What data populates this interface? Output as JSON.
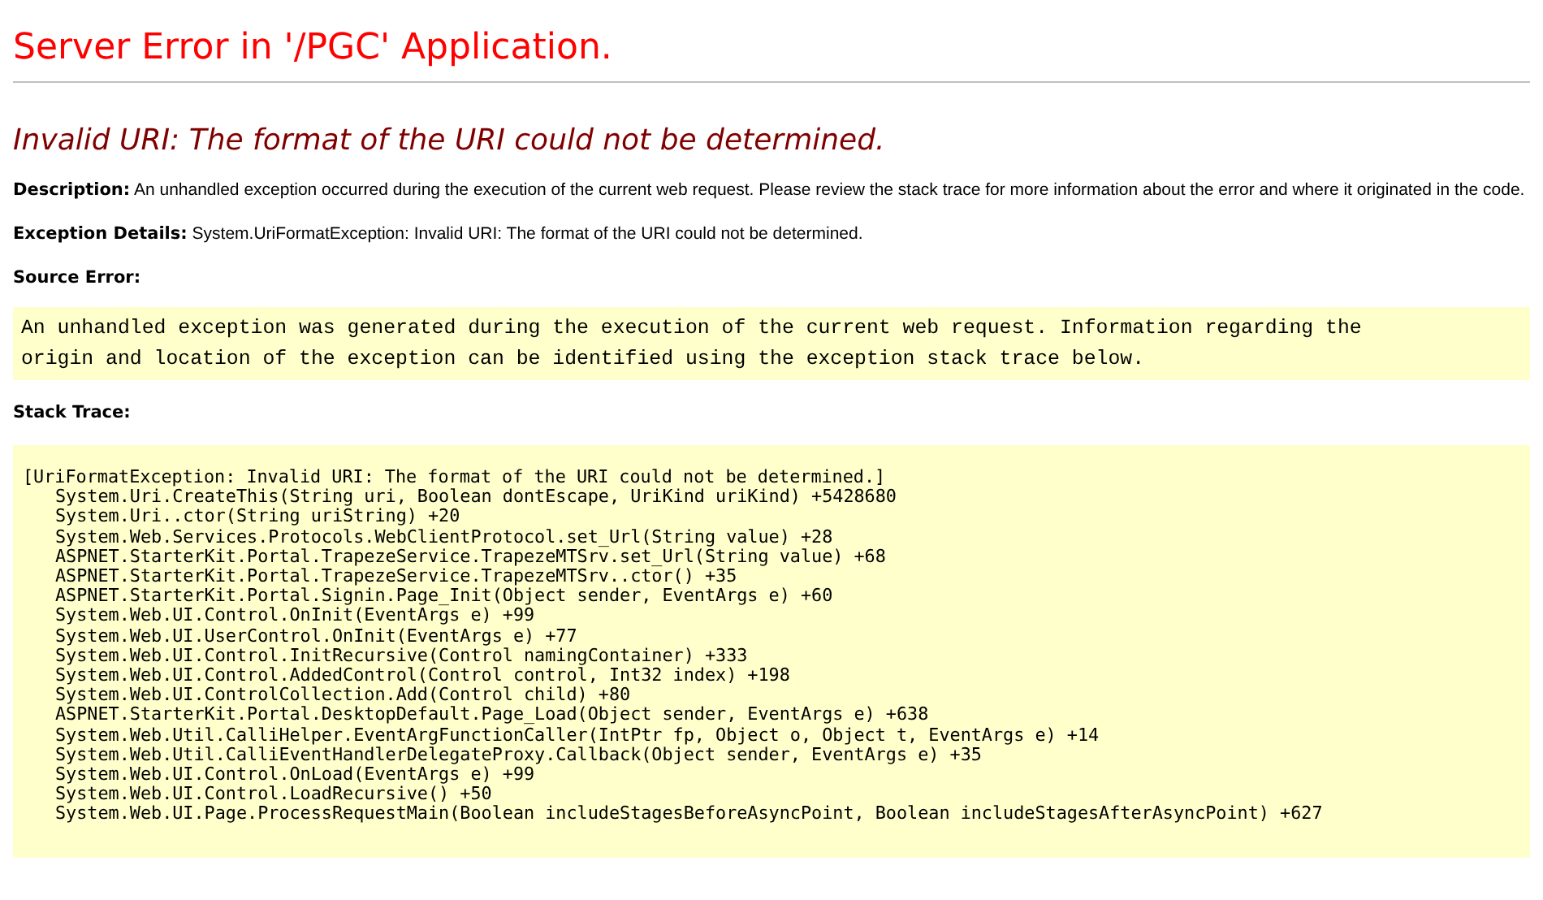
{
  "title": "Server Error in '/PGC' Application.",
  "error_heading": "Invalid URI: The format of the URI could not be determined.",
  "description": {
    "label": "Description:",
    "text": "An unhandled exception occurred during the execution of the current web request. Please review the stack trace for more information about the error and where it originated in the code."
  },
  "exception_details": {
    "label": "Exception Details:",
    "text": "System.UriFormatException: Invalid URI: The format of the URI could not be determined."
  },
  "source_error": {
    "label": "Source Error:",
    "lines": [
      "An unhandled exception was generated during the execution of the current web request. Information regarding the",
      "origin and location of the exception can be identified using the exception stack trace below."
    ]
  },
  "stack_trace": {
    "label": "Stack Trace:",
    "header": "[UriFormatException: Invalid URI: The format of the URI could not be determined.]",
    "frames": [
      "System.Uri.CreateThis(String uri, Boolean dontEscape, UriKind uriKind) +5428680",
      "System.Uri..ctor(String uriString) +20",
      "System.Web.Services.Protocols.WebClientProtocol.set_Url(String value) +28",
      "ASPNET.StarterKit.Portal.TrapezeService.TrapezeMTSrv.set_Url(String value) +68",
      "ASPNET.StarterKit.Portal.TrapezeService.TrapezeMTSrv..ctor() +35",
      "ASPNET.StarterKit.Portal.Signin.Page_Init(Object sender, EventArgs e) +60",
      "System.Web.UI.Control.OnInit(EventArgs e) +99",
      "System.Web.UI.UserControl.OnInit(EventArgs e) +77",
      "System.Web.UI.Control.InitRecursive(Control namingContainer) +333",
      "System.Web.UI.Control.AddedControl(Control control, Int32 index) +198",
      "System.Web.UI.ControlCollection.Add(Control child) +80",
      "ASPNET.StarterKit.Portal.DesktopDefault.Page_Load(Object sender, EventArgs e) +638",
      "System.Web.Util.CalliHelper.EventArgFunctionCaller(IntPtr fp, Object o, Object t, EventArgs e) +14",
      "System.Web.Util.CalliEventHandlerDelegateProxy.Callback(Object sender, EventArgs e) +35",
      "System.Web.UI.Control.OnLoad(EventArgs e) +99",
      "System.Web.UI.Control.LoadRecursive() +50",
      "System.Web.UI.Page.ProcessRequestMain(Boolean includeStagesBeforeAsyncPoint, Boolean includeStagesAfterAsyncPoint) +627"
    ]
  }
}
